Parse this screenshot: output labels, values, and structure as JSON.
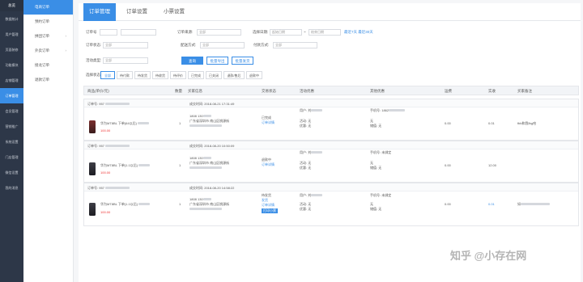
{
  "sidebar_primary": {
    "header": "总览",
    "items": [
      "数据统计",
      "用户管理",
      "页面装修",
      "功能模块",
      "店铺管理",
      "订单管理",
      "会员管理",
      "营销推广",
      "系统设置",
      "门店管理",
      "微信设置",
      "我的消息"
    ],
    "active_index": 5
  },
  "sidebar_secondary": {
    "items": [
      "电商订单",
      "预约订单",
      "拼团订单",
      "外卖订单",
      "接龙订单",
      "退款订单"
    ],
    "active_index": 0,
    "arrow": "›"
  },
  "tabs": [
    "订单管理",
    "订单设置",
    "小票设置"
  ],
  "filters": {
    "order_no_label": "订单号",
    "order_source_label": "订单来源:",
    "order_source_value": "全部",
    "date_label": "选择日期:",
    "date_start_placeholder": "起始日期",
    "date_sep": "~",
    "date_end_placeholder": "结束日期",
    "quick_dates": "最近7天  最近30天",
    "order_status_label": "订单状态:",
    "order_status_value": "全部",
    "delivery_label": "配送方式:",
    "delivery_value": "全部",
    "pay_label": "付款方式:",
    "pay_value": "全部",
    "activity_label": "活动类型:",
    "activity_value": "全部"
  },
  "actions": {
    "search": "查询",
    "batch_export": "批量导出",
    "batch_ship": "批量发货"
  },
  "status_tabs": {
    "label": "选择状态:",
    "items": [
      "全部",
      "待付款",
      "待发货",
      "待收货",
      "待评价",
      "已完成",
      "已关闭",
      "退款/售后",
      "退款中"
    ]
  },
  "table_headers": [
    "商品(单价/元)",
    "数量",
    "买家信息",
    "交易状态",
    "活动优惠",
    "其他优惠",
    "运费",
    "实收",
    "买家备注"
  ],
  "orders": [
    {
      "order_no": "订单号: 957",
      "created": "成交时间: 2018-08-21 17:31:49",
      "product_name": "华为MT8BL 下单(64以后)",
      "price": "100.00",
      "qty": "1",
      "buyer_phone": "1808 130",
      "buyer_addr": "广东省深圳市 南山区桃源街",
      "status": "已完成",
      "detail_link": "订单详情",
      "activity_user": "用户: 刘",
      "activity": "活动: 无",
      "discount": "优惠: 无",
      "other_phone": "手机号: 1862",
      "other_none": "无",
      "other_pay": "储值: 无",
      "freight": "0.00",
      "paid": "0.01",
      "remark": "fbb和我fbg哈"
    },
    {
      "order_no": "订单号: 957",
      "created": "成交时间: 2018-08-20 10:50:09",
      "product_name": "华为MT8BL 下单(1.1以后)",
      "price": "100.00",
      "qty": "1",
      "buyer_phone": "1808 130",
      "buyer_addr": "广东省深圳市 南山区桃源街",
      "status": "退款中",
      "detail_link": "订单详情",
      "activity_user": "用户: 刘",
      "activity": "活动: 无",
      "discount": "优惠: 无",
      "other_phone": "手机号: 未绑定",
      "other_none": "无",
      "other_pay": "储值: 无",
      "freight": "0.00",
      "paid": "12.00",
      "remark": ""
    },
    {
      "order_no": "订单号: 957",
      "created": "成交时间: 2018-08-20 14:58:22",
      "product_name": "华为MT8BL 下单(1.1以后)",
      "price": "100.00",
      "qty": "1",
      "buyer_phone": "1808 130",
      "buyer_addr": "广东省深圳市 南山区桃源街",
      "status": "待发货",
      "ship_link": "发货",
      "detail_link": "订单详情",
      "print_label": "打印小票",
      "activity_user": "用户: 刘",
      "activity": "活动: 无",
      "discount": "优惠: 无",
      "other_phone": "手机号: 未绑定",
      "other_none": "无",
      "other_pay": "储值: 无",
      "freight": "0.00",
      "paid": "0.01",
      "remark": "如"
    }
  ],
  "watermark": "知乎 @小存在网",
  "colors": {
    "accent": "#3a8ee6",
    "sidebar": "#2d3748",
    "price": "#e33333"
  }
}
